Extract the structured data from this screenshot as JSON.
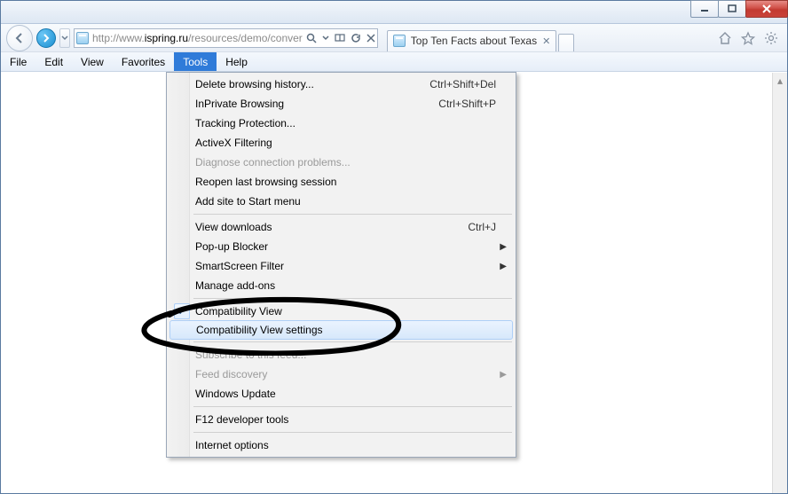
{
  "url": {
    "scheme": "http://",
    "prefix": "www.",
    "host": "ispring.ru",
    "path": "/resources/demo/conver"
  },
  "tab": {
    "title": "Top Ten Facts about Texas"
  },
  "menubar": [
    "File",
    "Edit",
    "View",
    "Favorites",
    "Tools",
    "Help"
  ],
  "active_menu_index": 4,
  "tools_menu": [
    {
      "type": "item",
      "label": "Delete browsing history...",
      "shortcut": "Ctrl+Shift+Del"
    },
    {
      "type": "item",
      "label": "InPrivate Browsing",
      "shortcut": "Ctrl+Shift+P"
    },
    {
      "type": "item",
      "label": "Tracking Protection..."
    },
    {
      "type": "item",
      "label": "ActiveX Filtering"
    },
    {
      "type": "item",
      "label": "Diagnose connection problems...",
      "disabled": true
    },
    {
      "type": "item",
      "label": "Reopen last browsing session"
    },
    {
      "type": "item",
      "label": "Add site to Start menu"
    },
    {
      "type": "sep"
    },
    {
      "type": "item",
      "label": "View downloads",
      "shortcut": "Ctrl+J"
    },
    {
      "type": "item",
      "label": "Pop-up Blocker",
      "submenu": true
    },
    {
      "type": "item",
      "label": "SmartScreen Filter",
      "submenu": true
    },
    {
      "type": "item",
      "label": "Manage add-ons"
    },
    {
      "type": "sep"
    },
    {
      "type": "item",
      "label": "Compatibility View",
      "checked": true
    },
    {
      "type": "item",
      "label": "Compatibility View settings",
      "hover": true
    },
    {
      "type": "sep"
    },
    {
      "type": "item",
      "label": "Subscribe to this feed...",
      "disabled": true
    },
    {
      "type": "item",
      "label": "Feed discovery",
      "submenu": true,
      "disabled": true
    },
    {
      "type": "item",
      "label": "Windows Update"
    },
    {
      "type": "sep"
    },
    {
      "type": "item",
      "label": "F12 developer tools"
    },
    {
      "type": "sep"
    },
    {
      "type": "item",
      "label": "Internet options"
    }
  ]
}
